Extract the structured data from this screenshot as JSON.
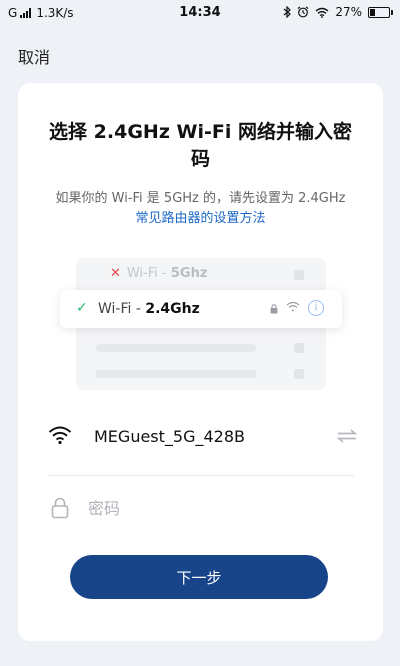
{
  "status_bar": {
    "carrier": "G",
    "speed": "1.3K/s",
    "time": "14:34",
    "battery": "27%",
    "battery_level": 0.27,
    "icons": [
      "bluetooth-icon",
      "alarm-icon",
      "wifi-icon",
      "battery-icon"
    ]
  },
  "header": {
    "cancel_label": "取消"
  },
  "card": {
    "title": "选择 2.4GHz Wi-Fi 网络并输入密码",
    "subtitle_text": "如果你的 Wi-Fi 是 5GHz 的，请先设置为 2.4GHz ",
    "subtitle_link": "常见路由器的设置方法"
  },
  "illustration": {
    "row_5g_prefix": "Wi-Fi - ",
    "row_5g_band": "5Ghz",
    "row_24g_prefix": "Wi-Fi - ",
    "row_24g_band": "2.4Ghz",
    "info_glyph": "i"
  },
  "network": {
    "ssid": "MEGuest_5G_428B"
  },
  "password": {
    "placeholder": "密码",
    "value": ""
  },
  "actions": {
    "next_label": "下一步"
  },
  "colors": {
    "primary_button": "#18458a",
    "link": "#1e68c8",
    "success_check": "#2bb673",
    "error_x": "#e6474a"
  }
}
